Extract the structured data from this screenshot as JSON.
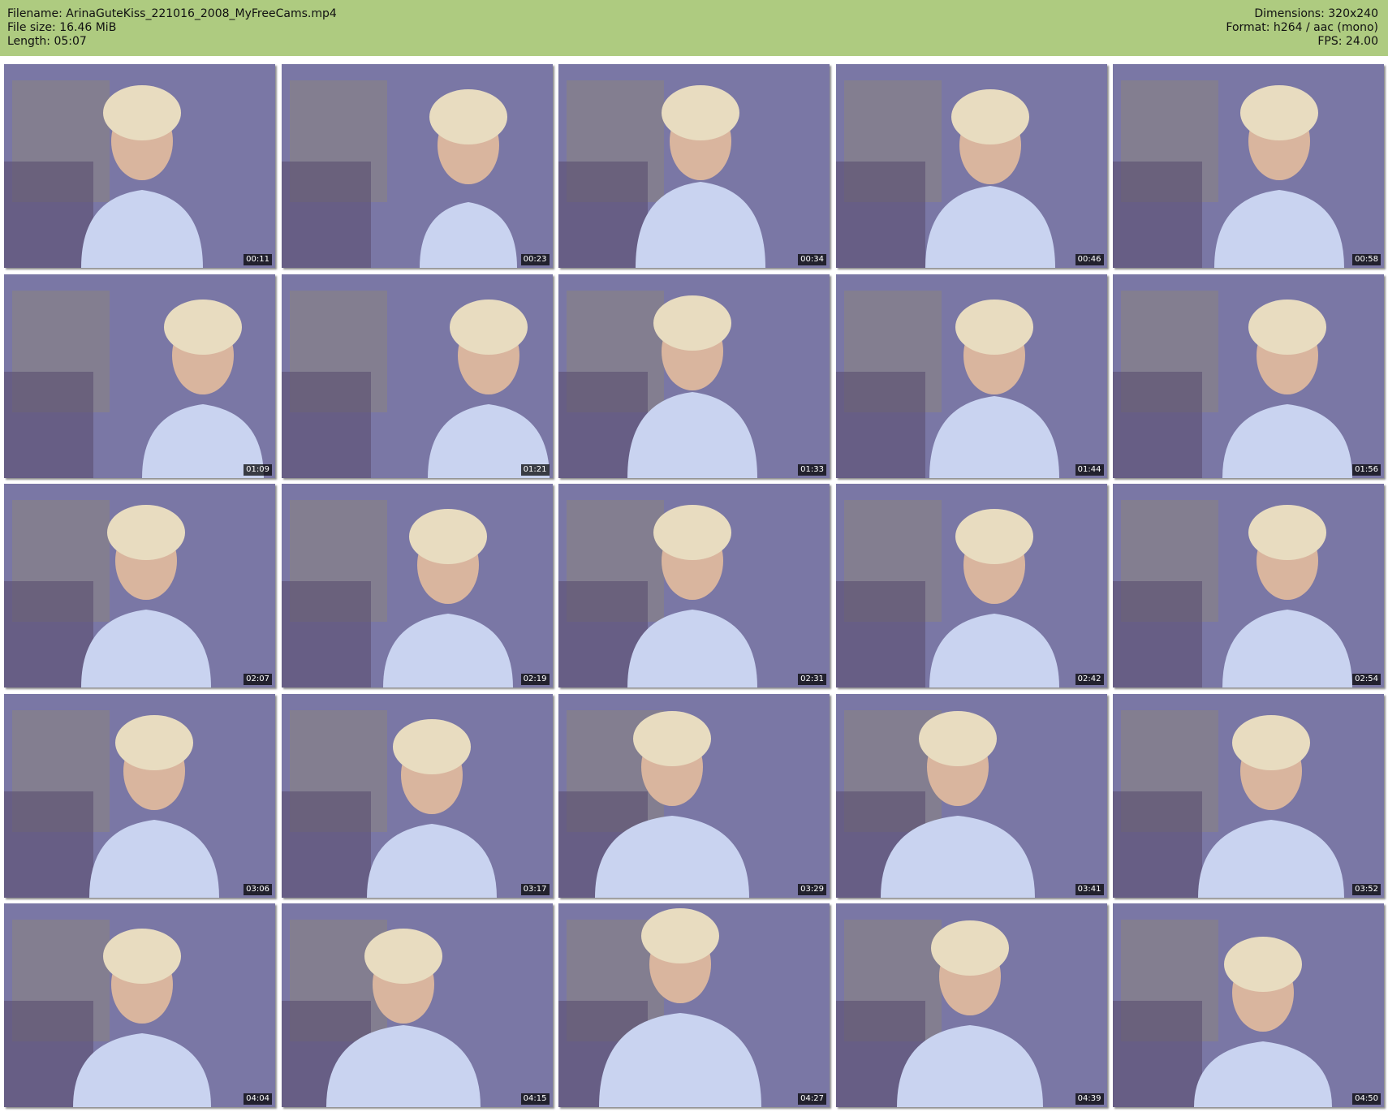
{
  "header": {
    "filename": "Filename: ArinaGuteKiss_221016_2008_MyFreeCams.mp4",
    "filesize": "File size: 16.46 MiB",
    "length": "Length: 05:07",
    "dimensions": "Dimensions: 320x240",
    "format": "Format: h264 / aac (mono)",
    "fps": "FPS: 24.00"
  },
  "colors": {
    "header_bg": "#aecb80",
    "timestamp_bg": "#000000"
  },
  "thumbnails": [
    {
      "time": "00:11"
    },
    {
      "time": "00:23"
    },
    {
      "time": "00:34"
    },
    {
      "time": "00:46"
    },
    {
      "time": "00:58"
    },
    {
      "time": "01:09"
    },
    {
      "time": "01:21"
    },
    {
      "time": "01:33"
    },
    {
      "time": "01:44"
    },
    {
      "time": "01:56"
    },
    {
      "time": "02:07"
    },
    {
      "time": "02:19"
    },
    {
      "time": "02:31"
    },
    {
      "time": "02:42"
    },
    {
      "time": "02:54"
    },
    {
      "time": "03:06"
    },
    {
      "time": "03:17"
    },
    {
      "time": "03:29"
    },
    {
      "time": "03:41"
    },
    {
      "time": "03:52"
    },
    {
      "time": "04:04"
    },
    {
      "time": "04:15"
    },
    {
      "time": "04:27"
    },
    {
      "time": "04:39"
    },
    {
      "time": "04:50"
    }
  ]
}
